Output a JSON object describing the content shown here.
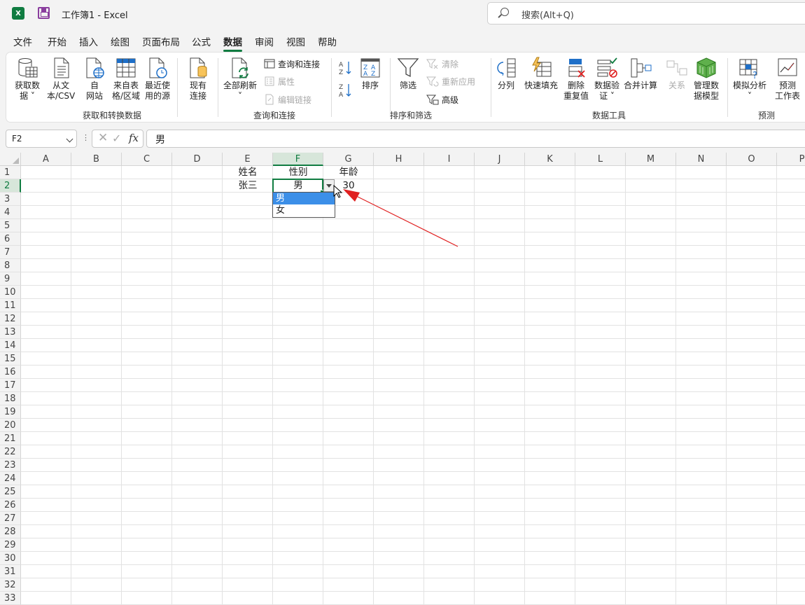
{
  "app": {
    "title": "工作簿1  -  Excel",
    "logo_letter": "X",
    "search_placeholder": "搜索(Alt+Q)"
  },
  "tabs": [
    "文件",
    "开始",
    "插入",
    "绘图",
    "页面布局",
    "公式",
    "数据",
    "审阅",
    "视图",
    "帮助"
  ],
  "active_tab": "数据",
  "ribbon": {
    "groups": {
      "get": "获取和转换数据",
      "query": "查询和连接",
      "sort": "排序和筛选",
      "tools": "数据工具",
      "forecast": "预测"
    },
    "buttons": {
      "get_data": "获取数\n据 ˅",
      "from_text": "从文\n本/CSV",
      "from_web": "自\n网站",
      "from_table": "来自表\n格/区域",
      "recent": "最近使\n用的源",
      "existing": "现有\n连接",
      "refresh_all": "全部刷新\n˅",
      "queries": "查询和连接",
      "properties": "属性",
      "edit_links": "编辑链接",
      "sort": "排序",
      "filter": "筛选",
      "clear": "清除",
      "reapply": "重新应用",
      "advanced": "高级",
      "split": "分列",
      "flash_fill": "快速填充",
      "remove_dup": "删除\n重复值",
      "validation": "数据验\n证 ˅",
      "consolidate": "合并计算",
      "relations": "关系",
      "data_model": "管理数\n据模型",
      "what_if": "模拟分析\n˅",
      "forecast_sheet": "预测\n工作表"
    }
  },
  "formula_bar": {
    "name_box": "F2",
    "dots": "⋮",
    "cancel": "✕",
    "enter": "✓",
    "fx": "fx",
    "content": "男"
  },
  "columns": [
    "A",
    "B",
    "C",
    "D",
    "E",
    "F",
    "G",
    "H",
    "I",
    "J",
    "K",
    "L",
    "M",
    "N",
    "O",
    "P"
  ],
  "selected_column": "F",
  "rows": [
    "1",
    "2",
    "3",
    "4",
    "5",
    "6",
    "7",
    "8",
    "9",
    "10",
    "11",
    "12",
    "13",
    "14",
    "15",
    "16",
    "17",
    "18",
    "19",
    "20",
    "21",
    "22",
    "23",
    "24",
    "25",
    "26",
    "27",
    "28",
    "29",
    "30",
    "31",
    "32",
    "33"
  ],
  "selected_row": "2",
  "cells": {
    "E1": "姓名",
    "F1": "性别",
    "G1": "年龄",
    "E2": "张三",
    "F2": "男",
    "G2": "30"
  },
  "dropdown": {
    "options": [
      "男",
      "女"
    ],
    "highlighted": "男"
  },
  "colors": {
    "accent": "#107c41",
    "annotation_arrow": "#e02020",
    "dropdown_highlight": "#3c8fe8"
  }
}
